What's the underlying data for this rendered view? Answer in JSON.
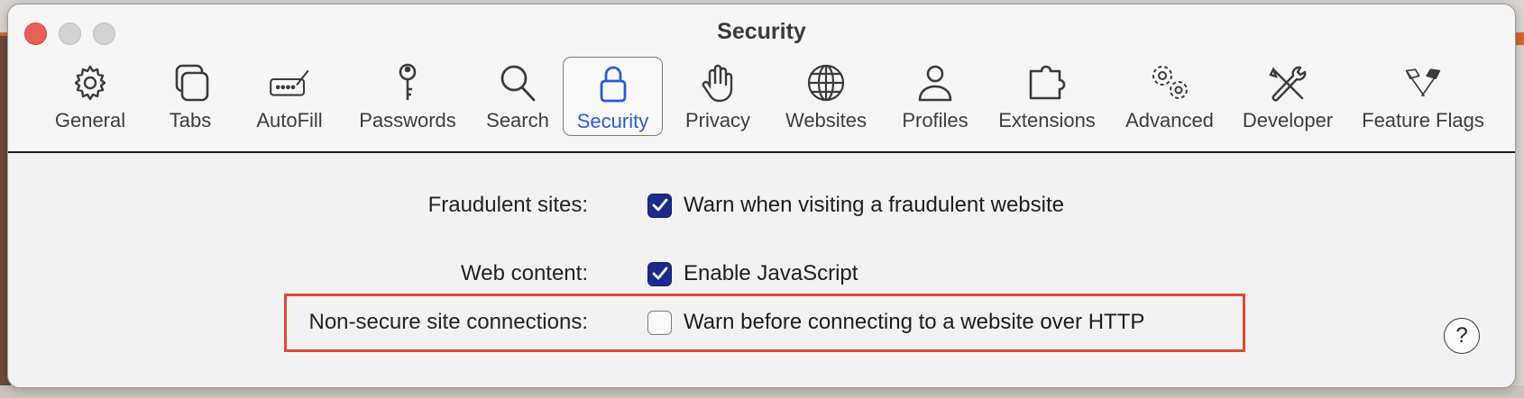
{
  "window": {
    "title": "Security"
  },
  "toolbar": {
    "items": [
      {
        "label": "General",
        "icon": "gear-icon"
      },
      {
        "label": "Tabs",
        "icon": "tabs-icon"
      },
      {
        "label": "AutoFill",
        "icon": "autofill-icon"
      },
      {
        "label": "Passwords",
        "icon": "key-icon"
      },
      {
        "label": "Search",
        "icon": "magnifier-icon"
      },
      {
        "label": "Security",
        "icon": "lock-icon",
        "active": true
      },
      {
        "label": "Privacy",
        "icon": "hand-icon"
      },
      {
        "label": "Websites",
        "icon": "globe-icon"
      },
      {
        "label": "Profiles",
        "icon": "person-icon"
      },
      {
        "label": "Extensions",
        "icon": "puzzle-icon"
      },
      {
        "label": "Advanced",
        "icon": "gears-icon"
      },
      {
        "label": "Developer",
        "icon": "tools-icon"
      },
      {
        "label": "Feature Flags",
        "icon": "flags-icon"
      }
    ]
  },
  "settings": {
    "fraudulent": {
      "label": "Fraudulent sites:",
      "option": "Warn when visiting a fraudulent website",
      "checked": true
    },
    "web_content": {
      "label": "Web content:",
      "option": "Enable JavaScript",
      "checked": true
    },
    "non_secure": {
      "label": "Non-secure site connections:",
      "option": "Warn before connecting to a website over HTTP",
      "checked": false
    }
  },
  "help": {
    "label": "?"
  },
  "colors": {
    "accent": "#2a5bd7",
    "checkbox_on": "#1b2a8c",
    "highlight": "#e04a36",
    "close": "#ec5f57"
  }
}
